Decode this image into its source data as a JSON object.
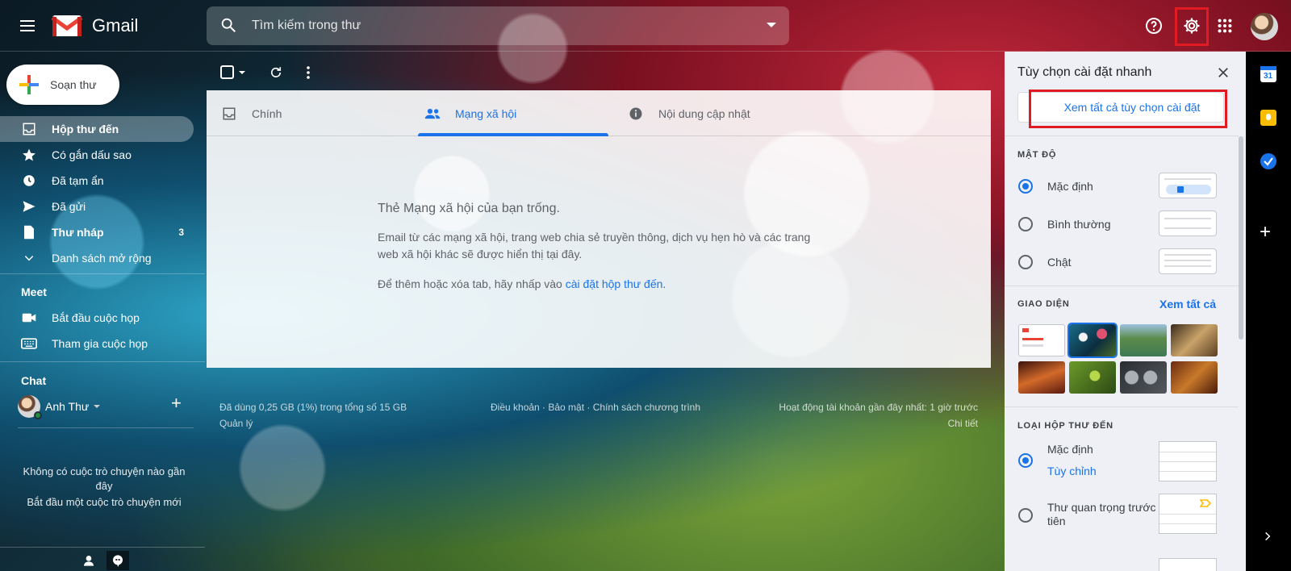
{
  "header": {
    "app_name": "Gmail",
    "search_placeholder": "Tìm kiếm trong thư"
  },
  "compose": {
    "label": "Soạn thư"
  },
  "nav": {
    "items": [
      {
        "label": "Hộp thư đến",
        "icon": "inbox-icon",
        "active": true
      },
      {
        "label": "Có gắn dấu sao",
        "icon": "star-icon"
      },
      {
        "label": "Đã tạm ẩn",
        "icon": "clock-icon"
      },
      {
        "label": "Đã gửi",
        "icon": "send-icon"
      },
      {
        "label": "Thư nháp",
        "icon": "draft-icon",
        "count": "3"
      },
      {
        "label": "Danh sách mở rộng",
        "icon": "chevron-down-icon"
      }
    ]
  },
  "meet": {
    "title": "Meet",
    "items": [
      {
        "label": "Bắt đầu cuộc họp",
        "icon": "video-icon"
      },
      {
        "label": "Tham gia cuộc họp",
        "icon": "keyboard-icon"
      }
    ]
  },
  "chat": {
    "title": "Chat",
    "user": "Anh Thư",
    "empty_line1": "Không có cuộc trò chuyện nào gần đây",
    "empty_line2": "Bắt đầu một cuộc trò chuyện mới"
  },
  "tabs": [
    {
      "label": "Chính",
      "icon": "inbox-tab-icon"
    },
    {
      "label": "Mạng xã hội",
      "icon": "people-icon",
      "active": true
    },
    {
      "label": "Nội dung cập nhật",
      "icon": "info-icon"
    }
  ],
  "empty": {
    "title": "Thẻ Mạng xã hội của bạn trống.",
    "desc": "Email từ các mạng xã hội, trang web chia sẻ truyền thông, dịch vụ hẹn hò và các trang web xã hội khác sẽ được hiển thị tại đây.",
    "hint_prefix": "Để thêm hoặc xóa tab, hãy nhấp vào ",
    "hint_link": "cài đặt hộp thư đến",
    "hint_suffix": "."
  },
  "footer": {
    "storage": "Đã dùng 0,25 GB (1%) trong tổng số 15 GB",
    "manage": "Quản lý",
    "links": "Điều khoản · Bảo mật · Chính sách chương trình",
    "activity": "Hoạt động tài khoản gần đây nhất: 1 giờ trước",
    "details": "Chi tiết"
  },
  "quick_settings": {
    "title": "Tùy chọn cài đặt nhanh",
    "see_all_button": "Xem tất cả tùy chọn cài đặt",
    "density": {
      "title": "MẬT ĐỘ",
      "options": [
        "Mặc định",
        "Bình thường",
        "Chật"
      ],
      "selected": "Mặc định"
    },
    "theme": {
      "title": "GIAO DIỆN",
      "see_all": "Xem tất cả"
    },
    "inbox_type": {
      "title": "LOẠI HỘP THƯ ĐẾN",
      "option1": "Mặc định",
      "option1_link": "Tùy chỉnh",
      "option2": "Thư quan trọng trước tiên"
    }
  },
  "colors": {
    "accent": "#1a73e8",
    "highlight": "#e11b22",
    "calendar": "#1a73e8",
    "keep": "#fbbc04",
    "tasks": "#1a73e8"
  }
}
